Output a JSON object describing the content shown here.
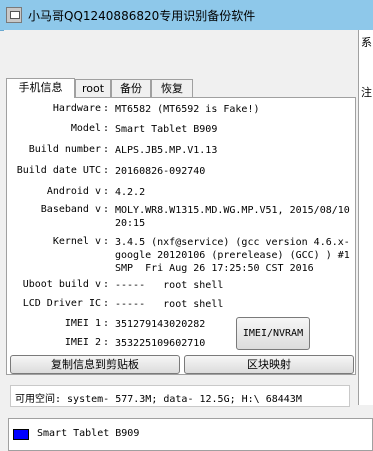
{
  "window": {
    "title": "小马哥QQ1240886820专用识别备份软件"
  },
  "right_panel": {
    "text_top": "系",
    "text_mid": "注"
  },
  "tabs": [
    {
      "label": "手机信息"
    },
    {
      "label": "root"
    },
    {
      "label": "备份"
    },
    {
      "label": "恢复"
    }
  ],
  "phone_info": {
    "hardware": {
      "label": "Hardware",
      "value": "MT6582 (MT6592 is Fake!)"
    },
    "model": {
      "label": "Model",
      "value": "Smart Tablet B909"
    },
    "build_number": {
      "label": "Build number",
      "value": "ALPS.JB5.MP.V1.13"
    },
    "build_date": {
      "label": "Build date UTC",
      "value": "20160826-092740"
    },
    "android": {
      "label": "Android  v",
      "value": "4.2.2"
    },
    "baseband": {
      "label": "Baseband v",
      "value": "MOLY.WR8.W1315.MD.WG.MP.V51, 2015/08/10 20:15"
    },
    "kernel": {
      "label": "Kernel v",
      "value": "3.4.5 (nxf@service) (gcc version 4.6.x-google 20120106 (prerelease) (GCC) ) #1 SMP  Fri Aug 26 17:25:50 CST 2016"
    },
    "uboot": {
      "label": "Uboot build v",
      "value": "-----   root shell"
    },
    "lcd": {
      "label": "LCD Driver IC",
      "value": "-----   root shell"
    },
    "imei1": {
      "label": "IMEI 1",
      "value": "351279143020282"
    },
    "imei2": {
      "label": "IMEI 2",
      "value": "353225109602710"
    },
    "separator": ":"
  },
  "buttons": {
    "imei_nvram": "IMEI/NVRAM",
    "copy_info": "复制信息到剪贴板",
    "block_map": "区块映射"
  },
  "storage": {
    "text": "可用空间: system- 577.3M; data- 12.5G;  H:\\ 68443M"
  },
  "device_list": {
    "items": [
      {
        "name": "Smart Tablet B909",
        "color": "#0000ff"
      }
    ]
  },
  "colors": {
    "titlebar": "#8ec8ea",
    "device_marker": "#0000ff"
  }
}
